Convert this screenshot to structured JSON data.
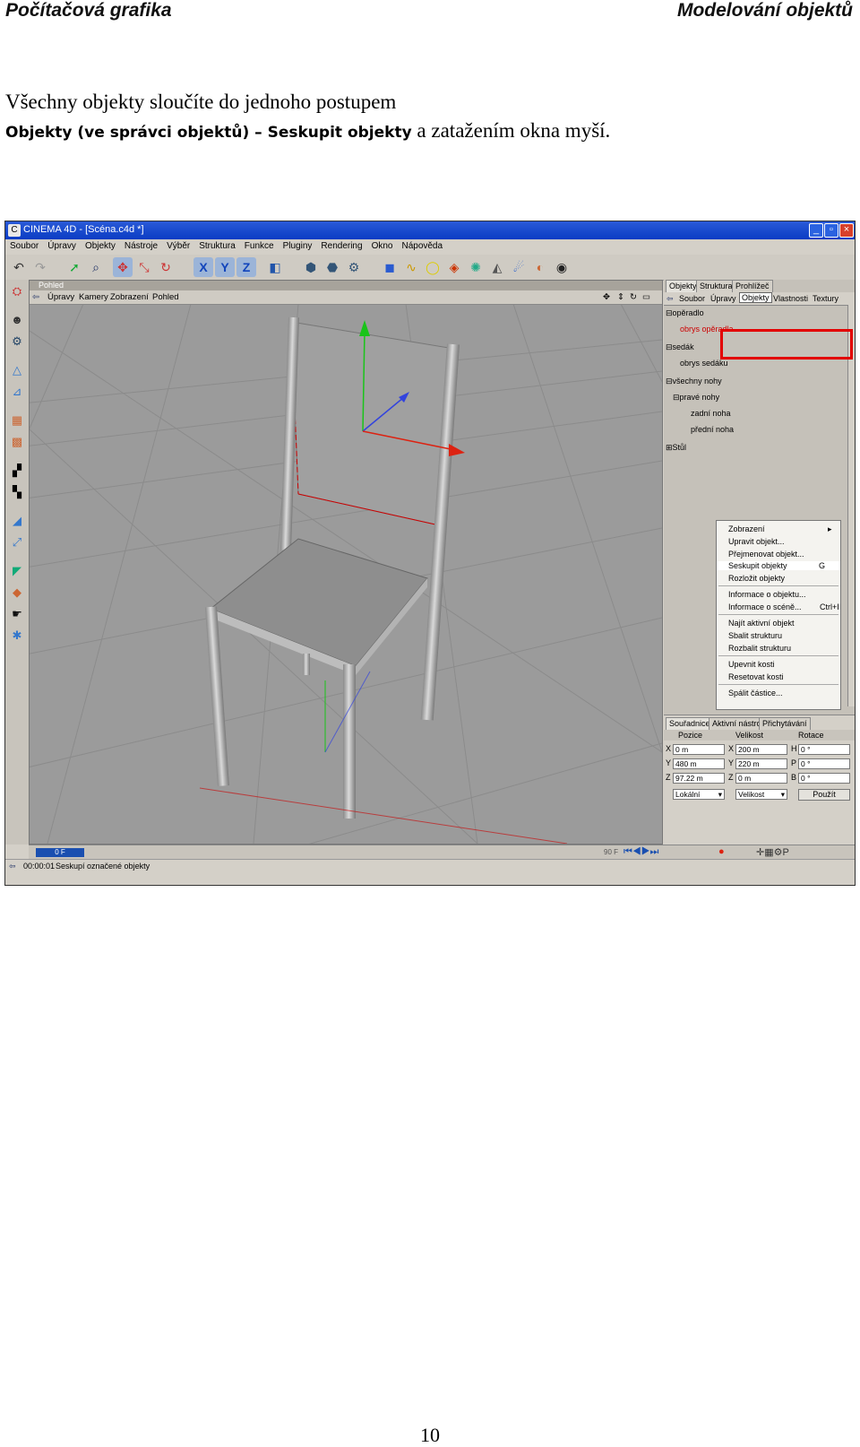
{
  "header": {
    "left": "Počítačová grafika",
    "right": "Modelování objektů"
  },
  "paragraph": {
    "line1": "Všechny objekty sloučíte do jednoho postupem",
    "bold1": "Objekty (ve správci objektů) – Seskupit objekty",
    "rest": " a zatažením okna myší."
  },
  "page_number": "10",
  "app": {
    "title": "CINEMA 4D - [Scéna.c4d *]",
    "menu": [
      "Soubor",
      "Úpravy",
      "Objekty",
      "Nástroje",
      "Výběr",
      "Struktura",
      "Funkce",
      "Pluginy",
      "Rendering",
      "Okno",
      "Nápověda"
    ],
    "viewport_title": "Pohled",
    "viewport_menu": [
      "Úpravy",
      "Kamery",
      "Zobrazení",
      "Pohled"
    ],
    "panel_tabs": [
      "Objekty",
      "Struktura",
      "Prohlížeč"
    ],
    "panel_menu": [
      "Soubor",
      "Úpravy",
      "Objekty",
      "Vlastnosti",
      "Textury"
    ],
    "tree": [
      {
        "label": "opěradlo",
        "red": false
      },
      {
        "label": "obrys opěradla",
        "red": true
      },
      {
        "label": "sedák",
        "red": false
      },
      {
        "label": "obrys sedáku",
        "red": false
      },
      {
        "label": "všechny nohy",
        "red": false
      },
      {
        "label": "pravé nohy",
        "red": false
      },
      {
        "label": "zadní noha",
        "red": false
      },
      {
        "label": "přední noha",
        "red": false
      },
      {
        "label": "Stůl",
        "red": false
      }
    ],
    "dropdown": {
      "items": [
        "Zobrazení",
        "Upravit objekt...",
        "Přejmenovat objekt...",
        "Seskupit objekty",
        "Rozložit objekty",
        "Informace o objektu...",
        "Informace o scéně...",
        "Najít aktivní objekt",
        "Sbalit strukturu",
        "Rozbalit strukturu",
        "Upevnit kosti",
        "Resetovat kosti",
        "Spálit částice..."
      ],
      "shortcut_group": "G",
      "shortcut_scene": "Ctrl+I"
    },
    "attr_tabs": [
      "Souřadnice",
      "Aktivní nástroj",
      "Přichytávání"
    ],
    "attr_headers": [
      "Pozice",
      "Velikost",
      "Rotace"
    ],
    "coords": {
      "x": {
        "pos": "0 m",
        "size": "200 m",
        "rot": "0 °",
        "rot_label": "H"
      },
      "y": {
        "pos": "480 m",
        "size": "220 m",
        "rot": "0 °",
        "rot_label": "P"
      },
      "z": {
        "pos": "97.22 m",
        "size": "0 m",
        "rot": "0 °",
        "rot_label": "B"
      }
    },
    "mode_select": "Lokální",
    "size_select": "Velikost",
    "apply_button": "Použít",
    "timeline_start": "0 F",
    "timeline_end": "90 F",
    "status_time": "00:00:01",
    "status_text": "Seskupí označené objekty"
  }
}
